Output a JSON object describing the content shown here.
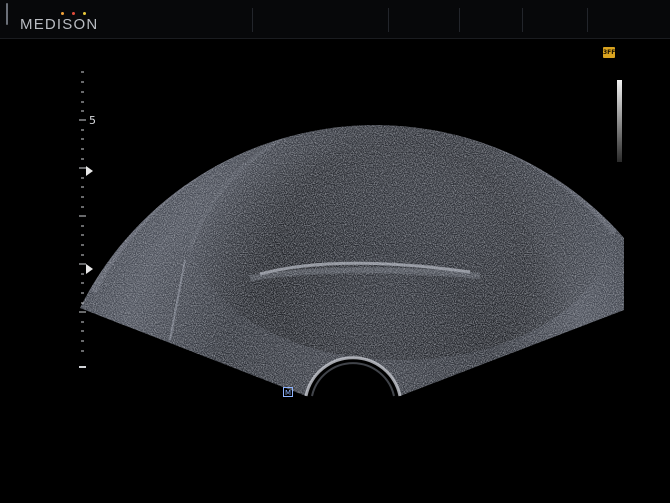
{
  "header": {
    "brand": "MEDISON",
    "brand_dot_colors": [
      "#f2a33a",
      "#e34b3b",
      "#e8c93a"
    ]
  },
  "scan": {
    "depth_label": "5",
    "colors": {
      "background": "#000000",
      "tissue": "#6f7480"
    }
  },
  "indicators": {
    "mode_badge": "3FF",
    "mode_badge_color": "#d9a31f",
    "probe_marker": "M",
    "probe_marker_color": "#8fb4ff"
  }
}
